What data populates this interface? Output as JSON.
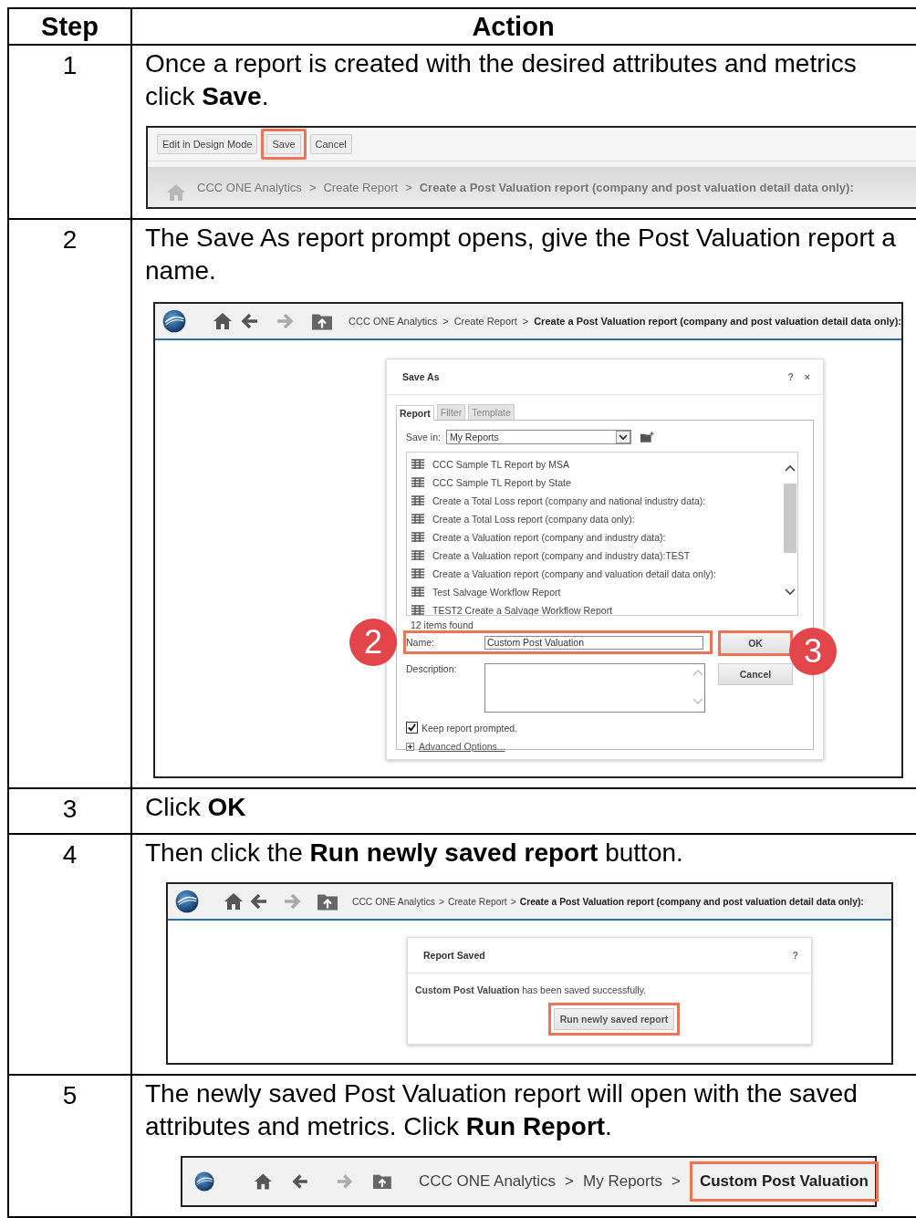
{
  "table": {
    "columns": [
      "Step",
      "Action"
    ],
    "rows": [
      {
        "step": "1",
        "text": "Once a report is created with the desired attributes and metrics click **Save**.",
        "screenshot": {
          "kind": "toolbar",
          "buttons": [
            {
              "label": "Edit in Design Mode",
              "highlighted": false
            },
            {
              "label": "Save",
              "highlighted": true
            },
            {
              "label": "Cancel",
              "highlighted": false
            }
          ],
          "crumbs": [
            {
              "text": "CCC ONE Analytics",
              "kind": "link"
            },
            {
              "text": ">",
              "kind": "sep"
            },
            {
              "text": "Create Report",
              "kind": "link"
            },
            {
              "text": ">",
              "kind": "sep"
            },
            {
              "text": "Create a Post Valuation report (company and post valuation detail data only):",
              "kind": "current"
            }
          ]
        }
      },
      {
        "step": "2",
        "text": "The Save As report prompt opens, give the Post Valuation report a name.",
        "screenshot": {
          "kind": "save_as",
          "crumbs": [
            {
              "text": "CCC ONE Analytics",
              "kind": "link"
            },
            {
              "text": ">",
              "kind": "sep"
            },
            {
              "text": "Create Report",
              "kind": "link"
            },
            {
              "text": ">",
              "kind": "sep"
            },
            {
              "text": "Create a Post Valuation report (company and post valuation detail data only):",
              "kind": "current"
            }
          ],
          "dialog": {
            "title": "Save As",
            "help": "?",
            "close": "×",
            "tabs": [
              {
                "label": "Report",
                "selected": true
              },
              {
                "label": "Filter",
                "selected": false
              },
              {
                "label": "Template",
                "selected": false
              }
            ],
            "save_in_label": "Save in:",
            "save_in_value": "My Reports",
            "items": [
              "CCC Sample TL Report by MSA",
              "CCC Sample TL Report by State",
              "Create a Total Loss report (company and national industry data):",
              "Create a Total Loss report (company data only):",
              "Create a Valuation report (company and industry data):",
              "Create a Valuation report (company and industry data):TEST",
              "Create a Valuation report (company and valuation detail data only):",
              "Test Salvage Workflow Report",
              "TEST2 Create a Salvage Workflow Report"
            ],
            "count": "12 items found",
            "name_label": "Name:",
            "name_value": "Custom Post Valuation",
            "name_highlighted": true,
            "name_callout": "2",
            "description_label": "Description:",
            "ok": {
              "label": "OK",
              "highlighted": true,
              "callout": "3"
            },
            "cancel": {
              "label": "Cancel",
              "highlighted": false
            },
            "keep_prompted": {
              "label": "Keep report prompted.",
              "checked": true
            },
            "advanced": "Advanced Options..."
          }
        }
      },
      {
        "step": "3",
        "text": "Click **OK**"
      },
      {
        "step": "4",
        "text": "Then click the **Run newly saved report** button.",
        "screenshot": {
          "kind": "report_saved",
          "crumbs": [
            {
              "text": "CCC ONE Analytics",
              "kind": "link"
            },
            {
              "text": ">",
              "kind": "sep"
            },
            {
              "text": "Create Report",
              "kind": "link"
            },
            {
              "text": ">",
              "kind": "sep"
            },
            {
              "text": "Create a Post Valuation report (company and post valuation detail data only):",
              "kind": "current"
            }
          ],
          "dialog": {
            "title": "Report Saved",
            "help": "?",
            "message": "**Custom Post Valuation** has been saved successfully.",
            "button": {
              "label": "Run newly saved report",
              "highlighted": true
            }
          }
        }
      },
      {
        "step": "5",
        "text": "The newly saved Post Valuation report will open with the saved attributes and metrics. Click **Run Report**.",
        "screenshot": {
          "kind": "nav",
          "crumbs": [
            {
              "text": "CCC ONE Analytics",
              "kind": "link"
            },
            {
              "text": ">",
              "kind": "sep"
            },
            {
              "text": "My Reports",
              "kind": "link"
            },
            {
              "text": ">",
              "kind": "sep"
            },
            {
              "text": "Custom Post Valuation",
              "kind": "current",
              "highlighted": true
            }
          ]
        }
      }
    ]
  }
}
